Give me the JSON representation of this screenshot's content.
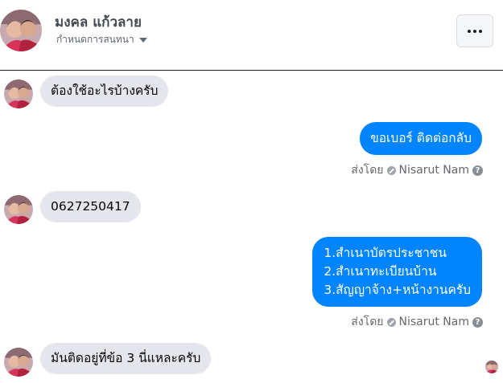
{
  "header": {
    "contact_name": "มงคล แก้วลาย",
    "subtitle": "กำหนดการสนทนา",
    "more_label": "···"
  },
  "messages": [
    {
      "direction": "incoming",
      "text": "ต้องใช้อะไรบ้างครับ"
    },
    {
      "direction": "outgoing",
      "text": "ขอเบอร์ ติดต่อกลับ",
      "sent_by_prefix": "ส่งโดย",
      "sent_by_name": "Nisarut Nam"
    },
    {
      "direction": "incoming",
      "text": "0627250417"
    },
    {
      "direction": "outgoing",
      "lines": [
        "1.สำเนาบัตรประชาชน",
        "2.สำเนาทะเบียนบ้าน",
        "3.สัญญาจ้าง+หน้างานครับ"
      ],
      "sent_by_prefix": "ส่งโดย",
      "sent_by_name": "Nisarut Nam"
    },
    {
      "direction": "incoming",
      "text": "มันติดอยู่ที่ข้อ 3 นี่แหละครับ"
    }
  ],
  "icons": {
    "more": "ellipsis-icon",
    "caret": "caret-down-icon",
    "sent_by": "blocked-circle-icon",
    "help": "help-icon"
  },
  "colors": {
    "outgoing_bubble": "#0084ff",
    "incoming_bubble": "#e4e6eb",
    "muted_text": "#65676b"
  }
}
